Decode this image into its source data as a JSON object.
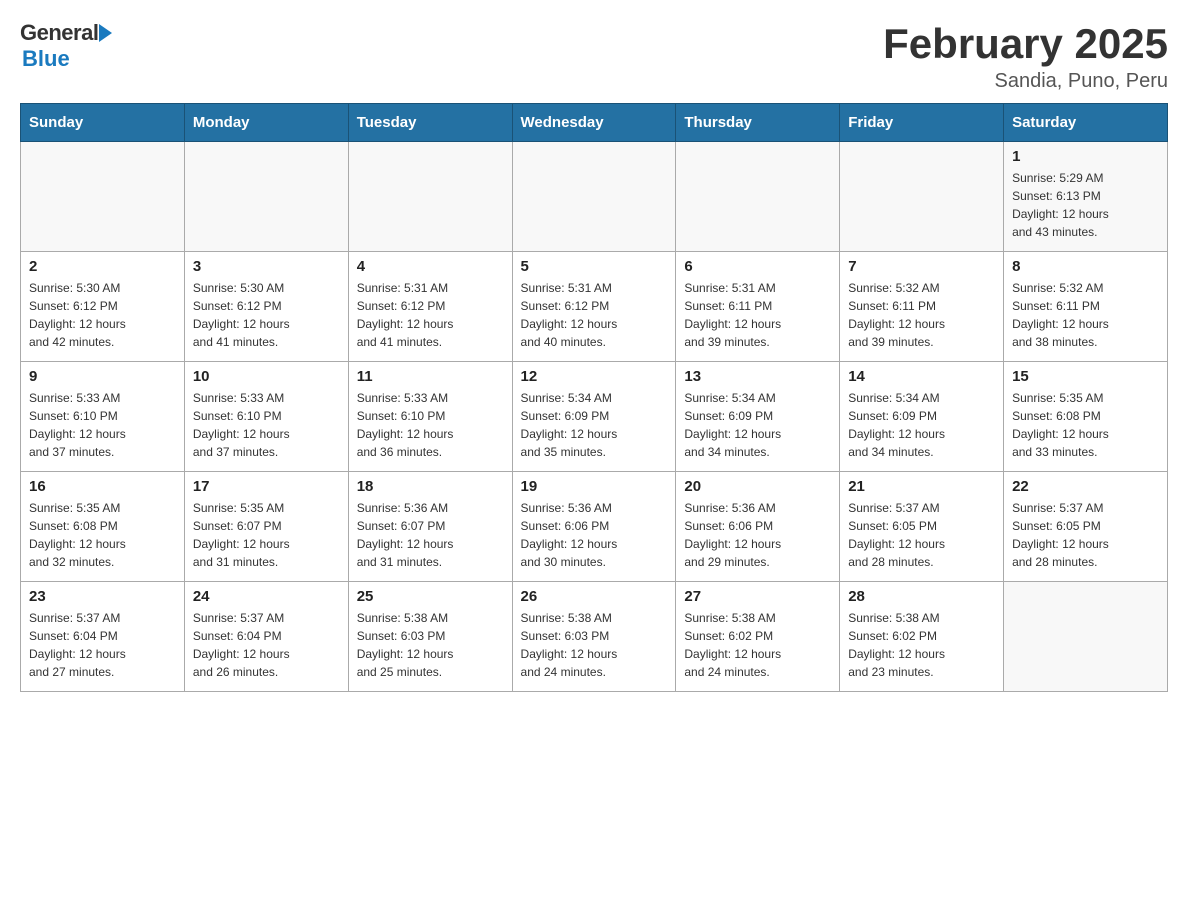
{
  "header": {
    "logo_general": "General",
    "logo_blue": "Blue",
    "month_year": "February 2025",
    "location": "Sandia, Puno, Peru"
  },
  "days_of_week": [
    "Sunday",
    "Monday",
    "Tuesday",
    "Wednesday",
    "Thursday",
    "Friday",
    "Saturday"
  ],
  "weeks": [
    [
      {
        "day": "",
        "info": ""
      },
      {
        "day": "",
        "info": ""
      },
      {
        "day": "",
        "info": ""
      },
      {
        "day": "",
        "info": ""
      },
      {
        "day": "",
        "info": ""
      },
      {
        "day": "",
        "info": ""
      },
      {
        "day": "1",
        "info": "Sunrise: 5:29 AM\nSunset: 6:13 PM\nDaylight: 12 hours\nand 43 minutes."
      }
    ],
    [
      {
        "day": "2",
        "info": "Sunrise: 5:30 AM\nSunset: 6:12 PM\nDaylight: 12 hours\nand 42 minutes."
      },
      {
        "day": "3",
        "info": "Sunrise: 5:30 AM\nSunset: 6:12 PM\nDaylight: 12 hours\nand 41 minutes."
      },
      {
        "day": "4",
        "info": "Sunrise: 5:31 AM\nSunset: 6:12 PM\nDaylight: 12 hours\nand 41 minutes."
      },
      {
        "day": "5",
        "info": "Sunrise: 5:31 AM\nSunset: 6:12 PM\nDaylight: 12 hours\nand 40 minutes."
      },
      {
        "day": "6",
        "info": "Sunrise: 5:31 AM\nSunset: 6:11 PM\nDaylight: 12 hours\nand 39 minutes."
      },
      {
        "day": "7",
        "info": "Sunrise: 5:32 AM\nSunset: 6:11 PM\nDaylight: 12 hours\nand 39 minutes."
      },
      {
        "day": "8",
        "info": "Sunrise: 5:32 AM\nSunset: 6:11 PM\nDaylight: 12 hours\nand 38 minutes."
      }
    ],
    [
      {
        "day": "9",
        "info": "Sunrise: 5:33 AM\nSunset: 6:10 PM\nDaylight: 12 hours\nand 37 minutes."
      },
      {
        "day": "10",
        "info": "Sunrise: 5:33 AM\nSunset: 6:10 PM\nDaylight: 12 hours\nand 37 minutes."
      },
      {
        "day": "11",
        "info": "Sunrise: 5:33 AM\nSunset: 6:10 PM\nDaylight: 12 hours\nand 36 minutes."
      },
      {
        "day": "12",
        "info": "Sunrise: 5:34 AM\nSunset: 6:09 PM\nDaylight: 12 hours\nand 35 minutes."
      },
      {
        "day": "13",
        "info": "Sunrise: 5:34 AM\nSunset: 6:09 PM\nDaylight: 12 hours\nand 34 minutes."
      },
      {
        "day": "14",
        "info": "Sunrise: 5:34 AM\nSunset: 6:09 PM\nDaylight: 12 hours\nand 34 minutes."
      },
      {
        "day": "15",
        "info": "Sunrise: 5:35 AM\nSunset: 6:08 PM\nDaylight: 12 hours\nand 33 minutes."
      }
    ],
    [
      {
        "day": "16",
        "info": "Sunrise: 5:35 AM\nSunset: 6:08 PM\nDaylight: 12 hours\nand 32 minutes."
      },
      {
        "day": "17",
        "info": "Sunrise: 5:35 AM\nSunset: 6:07 PM\nDaylight: 12 hours\nand 31 minutes."
      },
      {
        "day": "18",
        "info": "Sunrise: 5:36 AM\nSunset: 6:07 PM\nDaylight: 12 hours\nand 31 minutes."
      },
      {
        "day": "19",
        "info": "Sunrise: 5:36 AM\nSunset: 6:06 PM\nDaylight: 12 hours\nand 30 minutes."
      },
      {
        "day": "20",
        "info": "Sunrise: 5:36 AM\nSunset: 6:06 PM\nDaylight: 12 hours\nand 29 minutes."
      },
      {
        "day": "21",
        "info": "Sunrise: 5:37 AM\nSunset: 6:05 PM\nDaylight: 12 hours\nand 28 minutes."
      },
      {
        "day": "22",
        "info": "Sunrise: 5:37 AM\nSunset: 6:05 PM\nDaylight: 12 hours\nand 28 minutes."
      }
    ],
    [
      {
        "day": "23",
        "info": "Sunrise: 5:37 AM\nSunset: 6:04 PM\nDaylight: 12 hours\nand 27 minutes."
      },
      {
        "day": "24",
        "info": "Sunrise: 5:37 AM\nSunset: 6:04 PM\nDaylight: 12 hours\nand 26 minutes."
      },
      {
        "day": "25",
        "info": "Sunrise: 5:38 AM\nSunset: 6:03 PM\nDaylight: 12 hours\nand 25 minutes."
      },
      {
        "day": "26",
        "info": "Sunrise: 5:38 AM\nSunset: 6:03 PM\nDaylight: 12 hours\nand 24 minutes."
      },
      {
        "day": "27",
        "info": "Sunrise: 5:38 AM\nSunset: 6:02 PM\nDaylight: 12 hours\nand 24 minutes."
      },
      {
        "day": "28",
        "info": "Sunrise: 5:38 AM\nSunset: 6:02 PM\nDaylight: 12 hours\nand 23 minutes."
      },
      {
        "day": "",
        "info": ""
      }
    ]
  ]
}
